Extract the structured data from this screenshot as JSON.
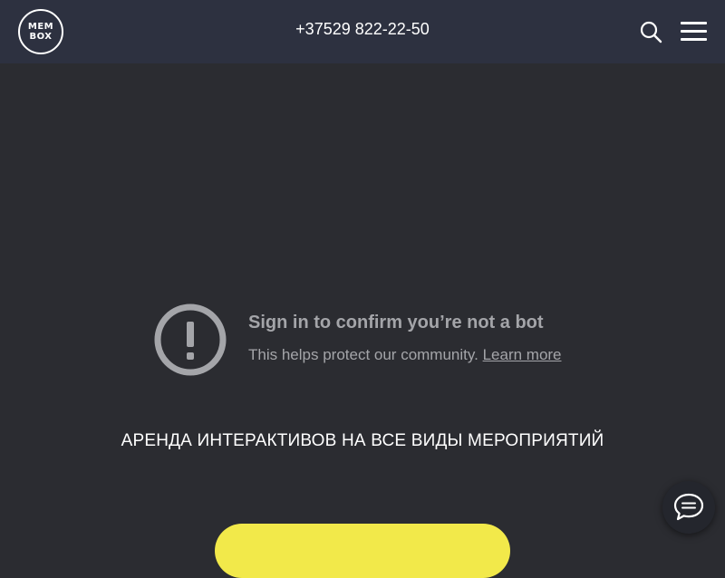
{
  "header": {
    "logo": {
      "line1": "МЕМ",
      "line2": "BOX"
    },
    "phone": "+37529 822-22-50",
    "search_icon": "search-icon",
    "menu_icon": "hamburger-menu-icon"
  },
  "bot_notice": {
    "icon": "exclamation-circle-icon",
    "title": "Sign in to confirm you’re not a bot",
    "text": "This helps protect our community.",
    "link": "Learn more"
  },
  "tagline": "АРЕНДА ИНТЕРАКТИВОВ НА ВСЕ ВИДЫ МЕРОПРИЯТИЙ",
  "cta": {
    "color": "#f2e94a"
  },
  "chat": {
    "icon": "chat-bubble-icon"
  },
  "colors": {
    "background": "#2b2c31",
    "header": "#2d3140",
    "muted_text": "#a4a5a9",
    "accent": "#f2e94a"
  }
}
